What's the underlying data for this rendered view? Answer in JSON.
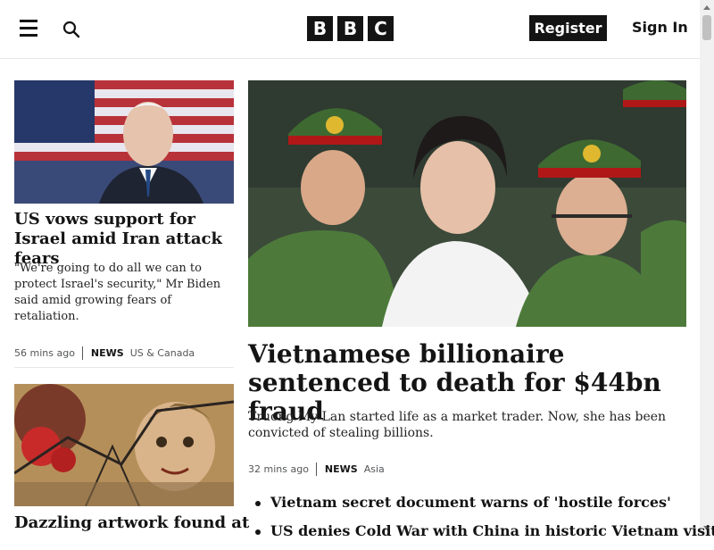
{
  "header": {
    "logo_letters": [
      "B",
      "B",
      "C"
    ],
    "register_label": "Register",
    "signin_label": "Sign In",
    "icons": {
      "menu": "menu-icon",
      "search": "search-icon"
    }
  },
  "stories": [
    {
      "headline": "US vows support for Israel amid Iran attack fears",
      "summary": "\"We're going to do all we can to protect Israel's security,\" Mr Biden said amid growing fears of retaliation.",
      "time": "56 mins ago",
      "section": "NEWS",
      "region": "US & Canada"
    },
    {
      "headline": "Dazzling artwork found at"
    }
  ],
  "main_story": {
    "headline": "Vietnamese billionaire sentenced to death for $44bn fraud",
    "summary": "Truong My Lan started life as a market trader. Now, she has been convicted of stealing billions.",
    "time": "32 mins ago",
    "section": "NEWS",
    "region": "Asia",
    "related": [
      "Vietnam secret document warns of 'hostile forces'",
      "US denies Cold War with China in historic Vietnam visit"
    ]
  }
}
